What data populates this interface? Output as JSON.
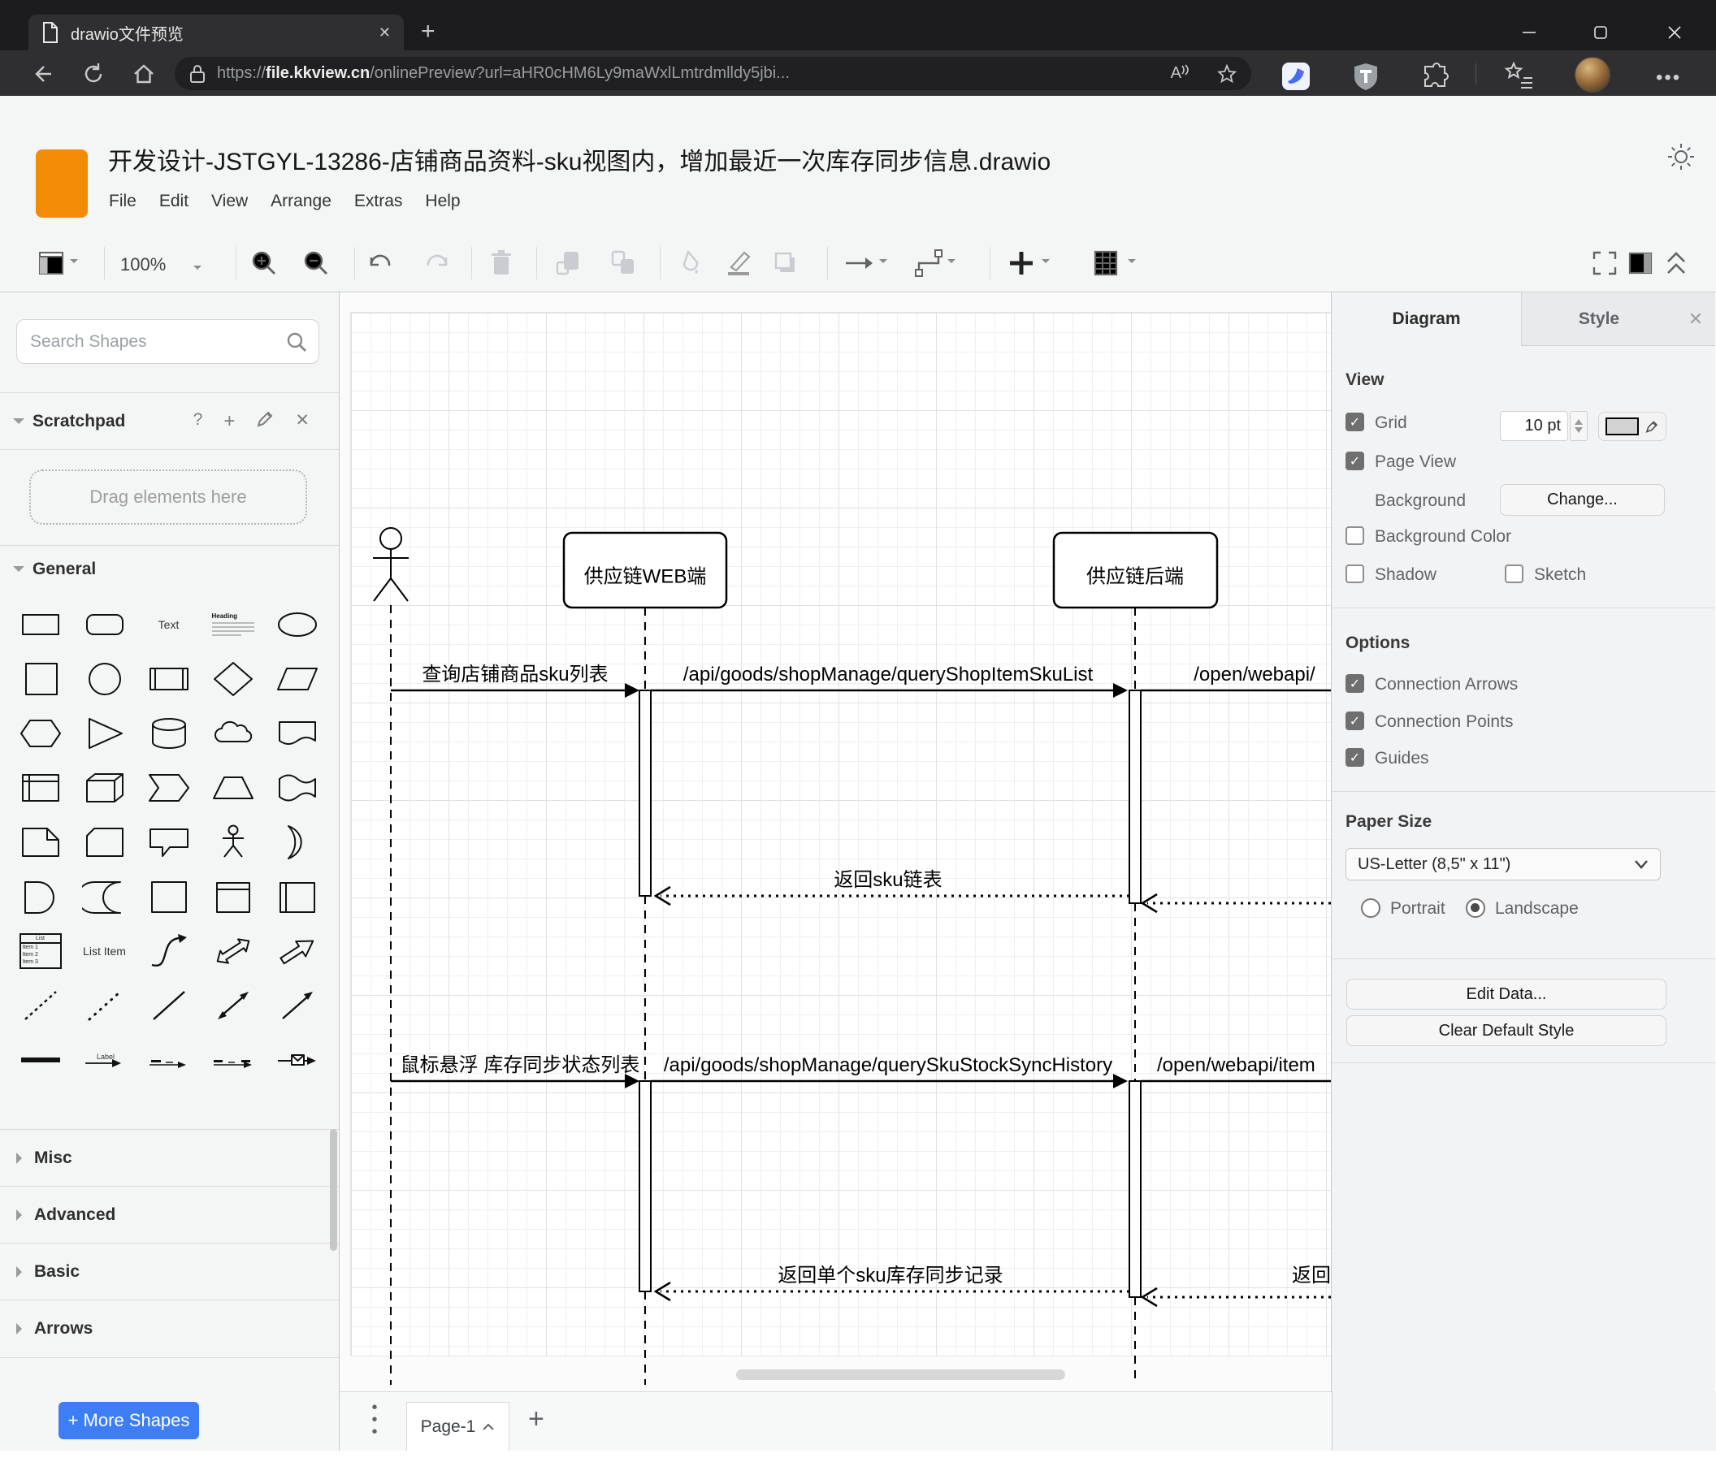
{
  "browser": {
    "tab_title": "drawio文件预览",
    "url_scheme": "https://",
    "url_domain": "file.kkview.cn",
    "url_path": "/onlinePreview?url=aHR0cHM6Ly9maWxlLmtrdmlldy5jbi...",
    "read_aloud": "A"
  },
  "app": {
    "title": "开发设计-JSTGYL-13286-店铺商品资料-sku视图内，增加最近一次库存同步信息.drawio",
    "menu": {
      "file": "File",
      "edit": "Edit",
      "view": "View",
      "arrange": "Arrange",
      "extras": "Extras",
      "help": "Help"
    },
    "zoom": "100%"
  },
  "sidebar": {
    "search_placeholder": "Search Shapes",
    "scratchpad_title": "Scratchpad",
    "drag_hint": "Drag elements here",
    "sections": {
      "general": "General",
      "misc": "Misc",
      "advanced": "Advanced",
      "basic": "Basic",
      "arrows": "Arrows"
    },
    "labels": {
      "text": "Text",
      "heading": "Heading",
      "list": "List",
      "item1": "Item 1",
      "item2": "Item 2",
      "item3": "Item 3",
      "list_item": "List Item",
      "label": "Label"
    },
    "more_shapes": "+ More Shapes"
  },
  "diagram": {
    "participants": {
      "web": "供应链WEB端",
      "backend": "供应链后端"
    },
    "messages": {
      "m1": "查询店铺商品sku列表",
      "m2": "/api/goods/shopManage/queryShopItemSkuList",
      "m3": "/open/webapi/",
      "r1": "返回sku链表",
      "m4": "鼠标悬浮 库存同步状态列表",
      "m5": "/api/goods/shopManage/querySkuStockSyncHistory",
      "m6": "/open/webapi/item",
      "r2": "返回单个sku库存同步记录",
      "r3": "返回"
    }
  },
  "panel": {
    "tabs": {
      "diagram": "Diagram",
      "style": "Style"
    },
    "view": {
      "title": "View",
      "grid": "Grid",
      "grid_size": "10 pt",
      "page_view": "Page View",
      "background": "Background",
      "change": "Change...",
      "background_color": "Background Color",
      "shadow": "Shadow",
      "sketch": "Sketch"
    },
    "options": {
      "title": "Options",
      "connection_arrows": "Connection Arrows",
      "connection_points": "Connection Points",
      "guides": "Guides"
    },
    "paper": {
      "title": "Paper Size",
      "value": "US-Letter (8,5\" x 11\")",
      "portrait": "Portrait",
      "landscape": "Landscape"
    },
    "buttons": {
      "edit_data": "Edit Data...",
      "clear_default_style": "Clear Default Style"
    }
  },
  "footer": {
    "page_tab": "Page-1"
  },
  "colors": {
    "accent_blue": "#3d7ef5",
    "logo_orange": "#f28c06",
    "browser_dark": "#1c1c1e",
    "panel_gray": "#f2f3f4"
  }
}
